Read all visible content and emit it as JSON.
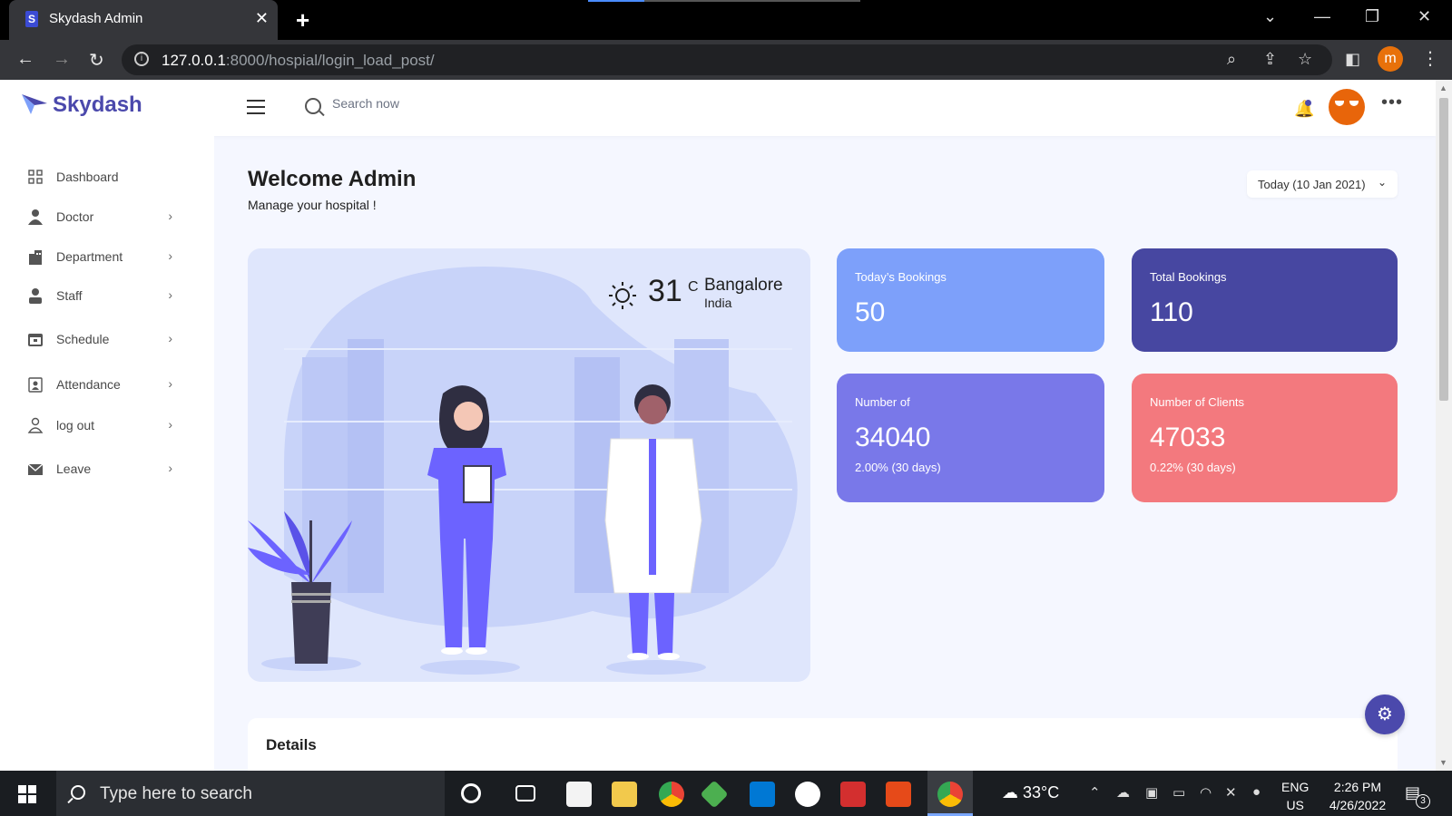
{
  "browser": {
    "tab_title": "Skydash Admin",
    "tab_favicon": "S",
    "url_host": "127.0.0.1",
    "url_path": ":8000/hospial/login_load_post/",
    "profile_initial": "m"
  },
  "header": {
    "logo_text": "Skydash",
    "search_placeholder": "Search now"
  },
  "sidebar": {
    "items": [
      {
        "label": "Dashboard",
        "icon": "grid-icon",
        "chevron": ""
      },
      {
        "label": "Doctor",
        "icon": "doctor-icon",
        "chevron": "›"
      },
      {
        "label": "Department",
        "icon": "building-icon",
        "chevron": "›"
      },
      {
        "label": "Staff",
        "icon": "staff-icon",
        "chevron": "›"
      },
      {
        "label": "Schedule",
        "icon": "calendar-icon",
        "chevron": "›"
      },
      {
        "label": "Attendance",
        "icon": "attendance-icon",
        "chevron": "›"
      },
      {
        "label": "log out",
        "icon": "user-icon",
        "chevron": "›"
      },
      {
        "label": "Leave",
        "icon": "mail-icon",
        "chevron": "›"
      }
    ]
  },
  "main": {
    "welcome": "Welcome Admin",
    "subtitle": "Manage your hospital !",
    "date_button": "Today (10 Jan 2021)",
    "weather": {
      "temp": "31",
      "unit": "C",
      "city": "Bangalore",
      "country": "India"
    },
    "cards": [
      {
        "label": "Today’s Bookings",
        "value": "50",
        "sub": "",
        "color": "#7da0fa"
      },
      {
        "label": "Total Bookings",
        "value": "110",
        "sub": "",
        "color": "#4747a1"
      },
      {
        "label": "Number of",
        "value": "34040",
        "sub": "2.00% (30 days)",
        "color": "#7978e9"
      },
      {
        "label": "Number of Clients",
        "value": "47033",
        "sub": "0.22% (30 days)",
        "color": "#f3797e"
      }
    ],
    "details_title": "Details"
  },
  "taskbar": {
    "search_text": "Type here to search",
    "weather": "33°C",
    "lang_top": "ENG",
    "lang_bottom": "US",
    "time": "2:26 PM",
    "date": "4/26/2022",
    "notification_count": "3"
  },
  "colors": {
    "brand": "#4b49ac",
    "page_bg": "#f5f7ff",
    "hero_bg": "#dfe6fc"
  }
}
